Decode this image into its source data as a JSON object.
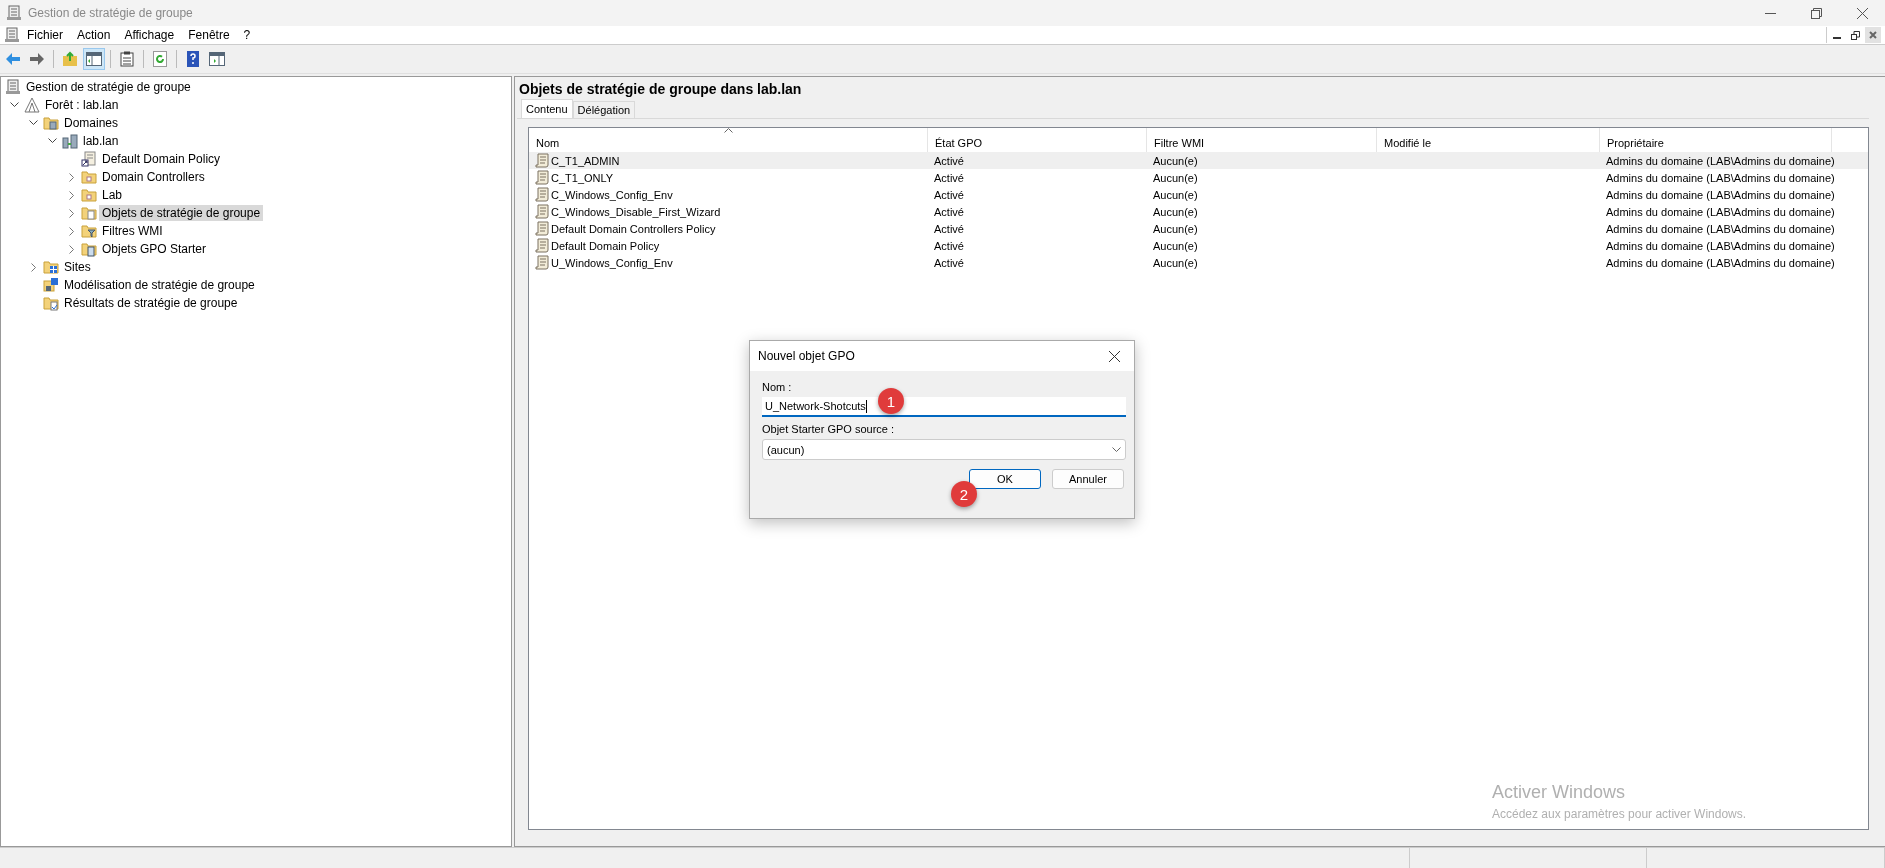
{
  "window": {
    "title": "Gestion de stratégie de groupe"
  },
  "menu": [
    "Fichier",
    "Action",
    "Affichage",
    "Fenêtre",
    "?"
  ],
  "toolbar": [
    {
      "kind": "back",
      "pressed": false
    },
    {
      "kind": "forward",
      "pressed": false
    },
    {
      "kind": "separator"
    },
    {
      "kind": "up",
      "pressed": false
    },
    {
      "kind": "tree-toggle",
      "pressed": true
    },
    {
      "kind": "separator"
    },
    {
      "kind": "export",
      "pressed": false
    },
    {
      "kind": "separator"
    },
    {
      "kind": "refresh",
      "pressed": false
    },
    {
      "kind": "separator"
    },
    {
      "kind": "help",
      "pressed": false
    },
    {
      "kind": "action-pane",
      "pressed": false
    }
  ],
  "tree": [
    {
      "label": "Gestion de stratégie de groupe",
      "kind": "console",
      "selected": false,
      "children": [
        {
          "label": "Forêt : lab.lan",
          "kind": "forest",
          "expanded": true,
          "selected": false,
          "children": [
            {
              "label": "Domaines",
              "kind": "domains",
              "expanded": true,
              "selected": false,
              "children": [
                {
                  "label": "lab.lan",
                  "kind": "domain",
                  "expanded": true,
                  "selected": false,
                  "children": [
                    {
                      "label": "Default Domain Policy",
                      "kind": "gpo-link",
                      "selected": false
                    },
                    {
                      "label": "Domain Controllers",
                      "kind": "ou",
                      "expanded": false,
                      "selected": false
                    },
                    {
                      "label": "Lab",
                      "kind": "ou",
                      "expanded": false,
                      "selected": false
                    },
                    {
                      "label": "Objets de stratégie de groupe",
                      "kind": "gpo-folder",
                      "expanded": false,
                      "selected": true
                    },
                    {
                      "label": "Filtres WMI",
                      "kind": "wmi",
                      "expanded": false,
                      "selected": false
                    },
                    {
                      "label": "Objets GPO Starter",
                      "kind": "starter",
                      "expanded": false,
                      "selected": false
                    }
                  ]
                }
              ]
            },
            {
              "label": "Sites",
              "kind": "sites",
              "expanded": false,
              "selected": false
            },
            {
              "label": "Modélisation de stratégie de groupe",
              "kind": "modeling",
              "selected": false
            },
            {
              "label": "Résultats de stratégie de groupe",
              "kind": "results",
              "selected": false
            }
          ]
        }
      ]
    }
  ],
  "content": {
    "heading": "Objets de stratégie de groupe dans lab.lan",
    "tabs": [
      {
        "label": "Contenu",
        "selected": true
      },
      {
        "label": "Délégation",
        "selected": false
      }
    ],
    "table": {
      "columns": [
        {
          "label": "Nom",
          "sorted": true
        },
        {
          "label": "État GPO",
          "sorted": false
        },
        {
          "label": "Filtre WMI",
          "sorted": false
        },
        {
          "label": "Modifié le",
          "sorted": false
        },
        {
          "label": "Propriétaire",
          "sorted": false
        }
      ],
      "rows": [
        {
          "selected": true,
          "cells": [
            "C_T1_ADMIN",
            "Activé",
            "Aucun(e)",
            "",
            "Admins du domaine (LAB\\Admins du domaine)"
          ]
        },
        {
          "selected": false,
          "cells": [
            "C_T1_ONLY",
            "Activé",
            "Aucun(e)",
            "",
            "Admins du domaine (LAB\\Admins du domaine)"
          ]
        },
        {
          "selected": false,
          "cells": [
            "C_Windows_Config_Env",
            "Activé",
            "Aucun(e)",
            "",
            "Admins du domaine (LAB\\Admins du domaine)"
          ]
        },
        {
          "selected": false,
          "cells": [
            "C_Windows_Disable_First_Wizard",
            "Activé",
            "Aucun(e)",
            "",
            "Admins du domaine (LAB\\Admins du domaine)"
          ]
        },
        {
          "selected": false,
          "cells": [
            "Default Domain Controllers Policy",
            "Activé",
            "Aucun(e)",
            "",
            "Admins du domaine (LAB\\Admins du domaine)"
          ]
        },
        {
          "selected": false,
          "cells": [
            "Default Domain Policy",
            "Activé",
            "Aucun(e)",
            "",
            "Admins du domaine (LAB\\Admins du domaine)"
          ]
        },
        {
          "selected": false,
          "cells": [
            "U_Windows_Config_Env",
            "Activé",
            "Aucun(e)",
            "",
            "Admins du domaine (LAB\\Admins du domaine)"
          ]
        }
      ]
    }
  },
  "dialog": {
    "title": "Nouvel objet GPO",
    "fields": [
      {
        "kind": "text",
        "label": "Nom :",
        "value": "U_Network-Shotcuts",
        "focused": true
      },
      {
        "kind": "select",
        "label": "Objet Starter GPO source :",
        "value": "(aucun)",
        "focused": false
      }
    ],
    "buttons": [
      {
        "label": "OK",
        "default": true
      },
      {
        "label": "Annuler",
        "default": false
      }
    ],
    "markers": [
      "1",
      "2"
    ]
  },
  "activation_notice": {
    "title": "Activer Windows",
    "text": "Accédez aux paramètres pour activer Windows."
  }
}
